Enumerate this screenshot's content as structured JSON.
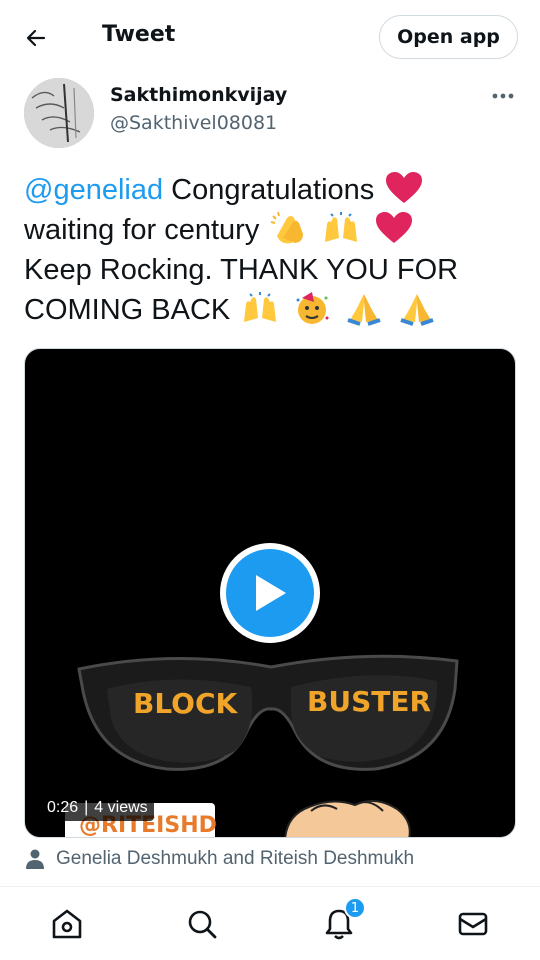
{
  "header": {
    "title": "Tweet",
    "open_app_label": "Open app"
  },
  "author": {
    "name": "Sakthimonkvijay",
    "handle": "@Sakthivel08081"
  },
  "tweet": {
    "mention": "@geneliad",
    "line1": " Congratulations",
    "line2": "waiting for century",
    "line3": "Keep Rocking. THANK YOU FOR COMING BACK",
    "emojis": [
      "red-heart",
      "clapping-hands",
      "raising-hands",
      "red-heart",
      "raising-hands",
      "party-face",
      "folded-hands",
      "folded-hands"
    ]
  },
  "video": {
    "duration": "0:26",
    "views": "4 views",
    "glasses_left_text": "BLOCK",
    "glasses_right_text": "BUSTER",
    "watermark": "@RITEISHD"
  },
  "tagged": {
    "text": "Genelia Deshmukh and Riteish Deshmukh"
  },
  "nav": {
    "items": [
      "home",
      "search",
      "notifications",
      "messages"
    ],
    "notification_count": "1"
  },
  "colors": {
    "accent": "#1d9bf0",
    "text": "#0f1419",
    "secondary": "#536471",
    "heart": "#e0245e",
    "lens_text": "#f0a52a"
  }
}
